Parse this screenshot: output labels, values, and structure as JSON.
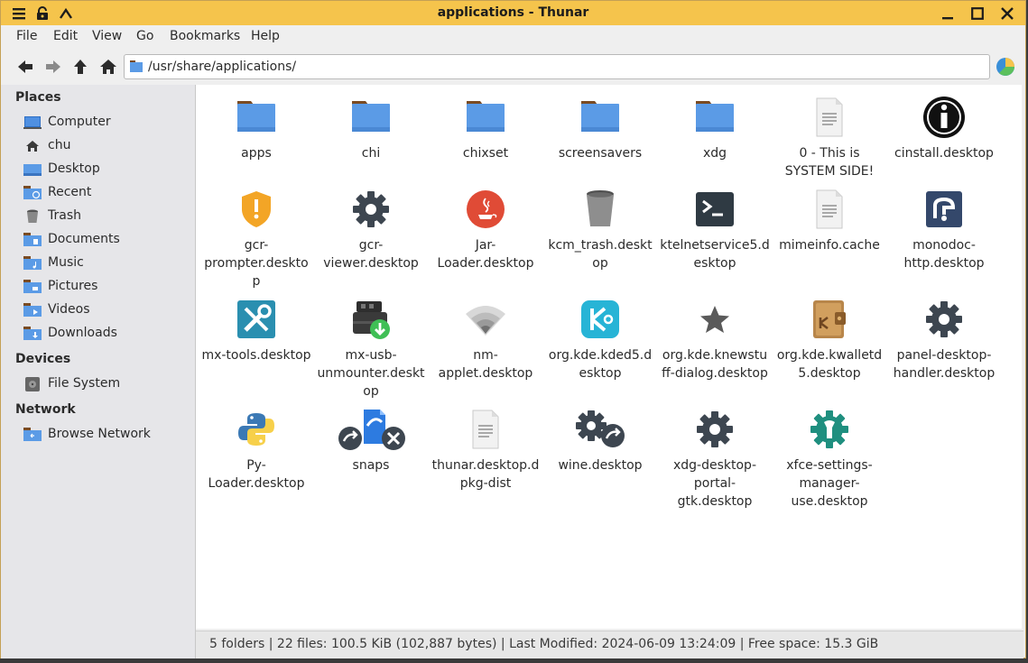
{
  "window": {
    "title": "applications - Thunar"
  },
  "menubar": [
    "File",
    "Edit",
    "View",
    "Go",
    "Bookmarks",
    "Help"
  ],
  "location": {
    "path": "/usr/share/applications/"
  },
  "sidebar": {
    "places_title": "Places",
    "places": [
      {
        "label": "Computer",
        "icon": "computer-icon"
      },
      {
        "label": "chu",
        "icon": "home-icon"
      },
      {
        "label": "Desktop",
        "icon": "desktop-folder-icon"
      },
      {
        "label": "Recent",
        "icon": "recent-folder-icon"
      },
      {
        "label": "Trash",
        "icon": "trash-icon"
      },
      {
        "label": "Documents",
        "icon": "documents-folder-icon"
      },
      {
        "label": "Music",
        "icon": "music-folder-icon"
      },
      {
        "label": "Pictures",
        "icon": "pictures-folder-icon"
      },
      {
        "label": "Videos",
        "icon": "videos-folder-icon"
      },
      {
        "label": "Downloads",
        "icon": "downloads-folder-icon"
      }
    ],
    "devices_title": "Devices",
    "devices": [
      {
        "label": "File System",
        "icon": "drive-icon"
      }
    ],
    "network_title": "Network",
    "network": [
      {
        "label": "Browse Network",
        "icon": "network-folder-icon"
      }
    ]
  },
  "files": [
    {
      "name": "apps",
      "icon": "folder"
    },
    {
      "name": "chi",
      "icon": "folder"
    },
    {
      "name": "chixset",
      "icon": "folder"
    },
    {
      "name": "screensavers",
      "icon": "folder"
    },
    {
      "name": "xdg",
      "icon": "folder"
    },
    {
      "name": "0 - This is\nSYSTEM SIDE!",
      "icon": "text-file"
    },
    {
      "name": "cinstall.desktop",
      "icon": "info"
    },
    {
      "name": "gcr-\nprompter.deskto\np",
      "icon": "shield"
    },
    {
      "name": "gcr-\nviewer.desktop",
      "icon": "gear"
    },
    {
      "name": "Jar-\nLoader.desktop",
      "icon": "java"
    },
    {
      "name": "kcm_trash.deskt\nop",
      "icon": "trash"
    },
    {
      "name": "ktelnetservice5.d\nesktop",
      "icon": "terminal"
    },
    {
      "name": "mimeinfo.cache",
      "icon": "text-file"
    },
    {
      "name": "monodoc-\nhttp.desktop",
      "icon": "monodoc"
    },
    {
      "name": "mx-tools.desktop",
      "icon": "tools"
    },
    {
      "name": "mx-usb-\nunmounter.deskt\nop",
      "icon": "usb"
    },
    {
      "name": "nm-\napplet.desktop",
      "icon": "wifi"
    },
    {
      "name": "org.kde.kded5.d\nesktop",
      "icon": "kde"
    },
    {
      "name": "org.kde.knewstu\nff-dialog.desktop",
      "icon": "star"
    },
    {
      "name": "org.kde.kwalletd\n5.desktop",
      "icon": "wallet"
    },
    {
      "name": "panel-desktop-\nhandler.desktop",
      "icon": "gear"
    },
    {
      "name": "Py-\nLoader.desktop",
      "icon": "python"
    },
    {
      "name": "snaps",
      "icon": "snaps"
    },
    {
      "name": "thunar.desktop.d\npkg-dist",
      "icon": "text-file"
    },
    {
      "name": "wine.desktop",
      "icon": "wine-gears"
    },
    {
      "name": "xdg-desktop-\nportal-\ngtk.desktop",
      "icon": "gear"
    },
    {
      "name": "xfce-settings-\nmanager-\nuse.desktop",
      "icon": "xfce-settings"
    }
  ],
  "statusbar": {
    "text": "5 folders  |  22 files: 100.5 KiB (102,887 bytes)  |  Last Modified: 2024-06-09 13:24:09  |  Free space: 15.3 GiB"
  },
  "colors": {
    "titlebar": "#f5c44c",
    "folder": "#5b9be6",
    "folder_tab": "#7a4b22"
  }
}
